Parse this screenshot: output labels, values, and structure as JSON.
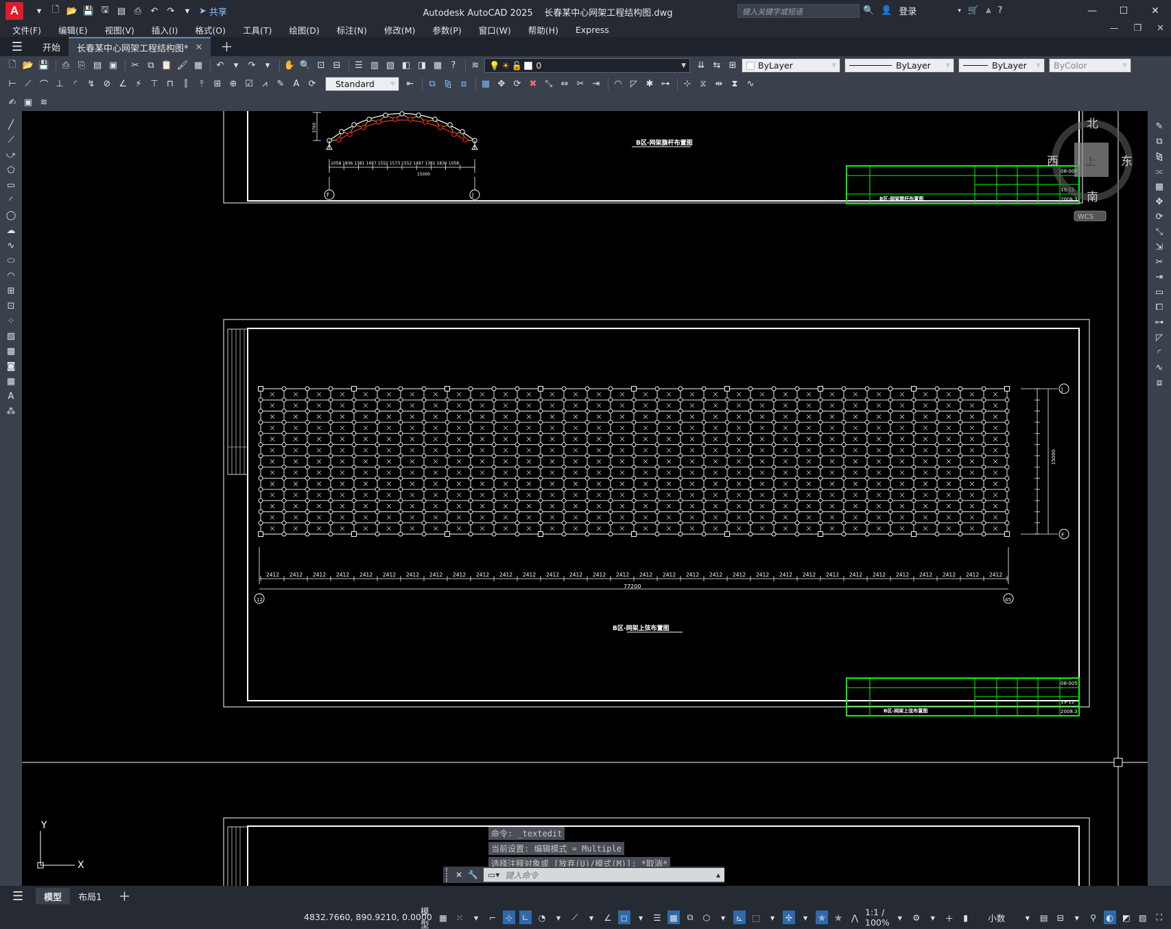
{
  "app": {
    "logo_letter": "A",
    "title": "Autodesk AutoCAD 2025",
    "document": "长春某中心网架工程结构图.dwg",
    "share_label": "共享",
    "search_placeholder": "键入关键字或短语",
    "login_label": "登录"
  },
  "menu": [
    "文件(F)",
    "编辑(E)",
    "视图(V)",
    "插入(I)",
    "格式(O)",
    "工具(T)",
    "绘图(D)",
    "标注(N)",
    "修改(M)",
    "参数(P)",
    "窗口(W)",
    "帮助(H)",
    "Express"
  ],
  "file_tabs": {
    "start": "开始",
    "active": "长春某中心网架工程结构图*"
  },
  "toolbar": {
    "layer_value": "0",
    "color_value": "ByLayer",
    "linetype_value": "ByLayer",
    "lineweight_value": "ByLayer",
    "plotstyle_value": "ByColor",
    "text_style": "Standard"
  },
  "viewcube": {
    "north": "北",
    "south": "南",
    "east": "东",
    "west": "西",
    "top_face": "上",
    "wcs": "WCS"
  },
  "drawing": {
    "sheet1_title": "B区-网架腹杆布置图",
    "sheet2_title": "B区-网架上弦布置图",
    "arch_height": "3760",
    "arch_dims": "1058 1836 1381 1497 1552 1573 1552 1497 1381 1836 1058",
    "arch_total": "15000",
    "grid_dim": "2412",
    "grid_total": "77200",
    "grid_side_total": "15000",
    "axis_F": "F",
    "axis_J": "J",
    "axis_12": "12",
    "axis_45": "45",
    "tb_drawing_no_1": "08-005",
    "tb_date_1": "2008.3",
    "tb_drawing_no_2": "08-005",
    "tb_date_2": "2008.3",
    "tb_sheet": "19-12"
  },
  "ucs": {
    "y": "Y",
    "x": "X"
  },
  "command": {
    "history": [
      "命令: _textedit",
      "当前设置: 编辑模式 = Multiple",
      "选择注释对象或 [放弃(U)/模式(M)]: *取消*"
    ],
    "placeholder": "键入命令"
  },
  "layout_tabs": [
    "模型",
    "布局1"
  ],
  "status": {
    "coords": "4832.7660, 890.9210, 0.0000",
    "model": "模型",
    "scale": "1:1 / 100%",
    "units": "小数"
  }
}
